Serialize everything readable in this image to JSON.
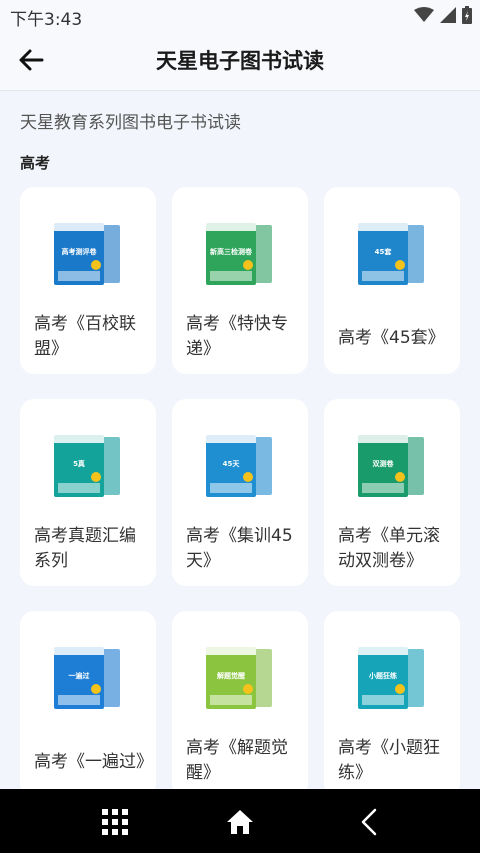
{
  "status_bar": {
    "time": "下午3:43",
    "icons": [
      "wifi-icon",
      "signal-icon",
      "battery-charging-icon"
    ]
  },
  "header": {
    "back_icon": "back-arrow-icon",
    "title": "天星电子图书试读"
  },
  "subtitle": "天星教育系列图书电子书试读",
  "section": {
    "title": "高考"
  },
  "books": [
    {
      "label": "高考《百校联盟》",
      "cover_text": "高考测评卷",
      "cover_color": "#1a79c9"
    },
    {
      "label": "高考《特快专递》",
      "cover_text": "新高三检测卷",
      "cover_color": "#2ea55b"
    },
    {
      "label": "高考《45套》",
      "cover_text": "45套",
      "cover_color": "#1f86cc"
    },
    {
      "label": "高考真题汇编系列",
      "cover_text": "5真",
      "cover_color": "#13a39a"
    },
    {
      "label": "高考《集训45天》",
      "cover_text": "45天",
      "cover_color": "#1f8fd2"
    },
    {
      "label": "高考《单元滚动双测卷》",
      "cover_text": "双测卷",
      "cover_color": "#1a9b6b"
    },
    {
      "label": "高考《一遍过》",
      "cover_text": "一遍过",
      "cover_color": "#1e7ed6"
    },
    {
      "label": "高考《解题觉醒》",
      "cover_text": "解题觉醒",
      "cover_color": "#8bc53f"
    },
    {
      "label": "高考《小题狂练》",
      "cover_text": "小题狂练",
      "cover_color": "#16a5b8"
    }
  ],
  "nav_bar": {
    "icons": [
      "menu-grid-icon",
      "home-icon",
      "back-icon"
    ]
  },
  "colors": {
    "background": "#f2f5fb",
    "card": "#ffffff",
    "nav_bar": "#000000"
  }
}
